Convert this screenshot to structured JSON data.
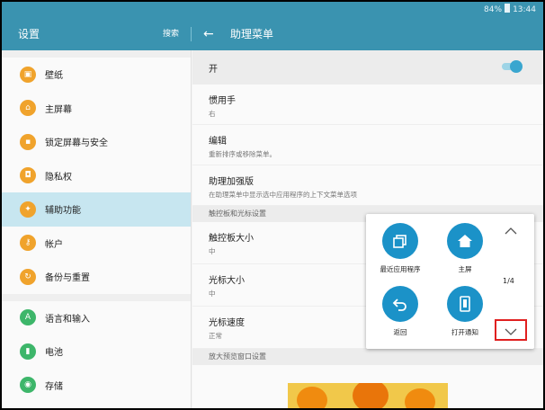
{
  "status": {
    "battery": "84%",
    "time": "13:44"
  },
  "appbar": {
    "title": "设置",
    "search": "搜索",
    "subtitle": "助理菜单"
  },
  "sidebar": {
    "items": [
      {
        "label": "壁纸",
        "icon": "image-icon"
      },
      {
        "label": "主屏幕",
        "icon": "home-icon"
      },
      {
        "label": "锁定屏幕与安全",
        "icon": "lock-icon"
      },
      {
        "label": "隐私权",
        "icon": "privacy-icon"
      },
      {
        "label": "辅助功能",
        "icon": "accessibility-icon",
        "selected": true
      },
      {
        "label": "帐户",
        "icon": "key-icon"
      },
      {
        "label": "备份与重置",
        "icon": "backup-icon"
      },
      {
        "label": "语言和输入",
        "icon": "language-icon"
      },
      {
        "label": "电池",
        "icon": "battery-icon"
      },
      {
        "label": "存储",
        "icon": "storage-icon"
      }
    ]
  },
  "content": {
    "toggle_label": "开",
    "toggle_on": true,
    "items": [
      {
        "title": "惯用手",
        "subtitle": "右"
      },
      {
        "title": "编辑",
        "subtitle": "重新排序或移除菜单。"
      },
      {
        "title": "助理加强版",
        "subtitle": "在助理菜单中显示选中应用程序的上下文菜单选项"
      }
    ],
    "section1": "触控板和光标设置",
    "items2": [
      {
        "title": "触控板大小",
        "subtitle": "中"
      },
      {
        "title": "光标大小",
        "subtitle": "中"
      },
      {
        "title": "光标速度",
        "subtitle": "正常"
      }
    ],
    "section2": "放大预览窗口设置"
  },
  "assistant_menu": {
    "buttons": [
      {
        "label": "最近应用程序",
        "icon": "recent-apps-icon"
      },
      {
        "label": "主屏",
        "icon": "home-icon"
      },
      {
        "label": "返回",
        "icon": "back-icon"
      },
      {
        "label": "打开通知",
        "icon": "notification-icon"
      }
    ],
    "page_indicator": "1/4"
  },
  "colors": {
    "accent": "#3a93b0",
    "icon_orange": "#f0a32c",
    "icon_green": "#3db66a",
    "assist_blue": "#1b92c8"
  }
}
